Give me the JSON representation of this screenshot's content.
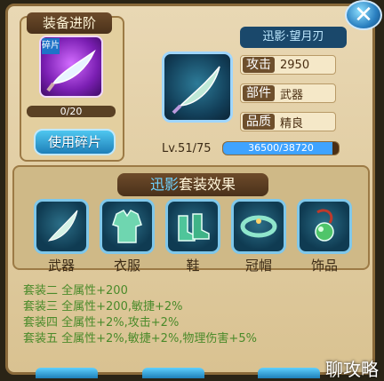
{
  "window": {
    "close_icon": "close-icon"
  },
  "upgrade_panel": {
    "title": "装备进阶",
    "item_icon": "curved-blade-icon",
    "fragment_tag": "碎片",
    "progress": {
      "text": "0/20",
      "current": 0,
      "max": 20
    },
    "use_button_label": "使用碎片"
  },
  "weapon": {
    "icon": "curved-blade-icon",
    "name": "迅影·望月刃",
    "stats": [
      {
        "label": "攻击",
        "value": "2950"
      },
      {
        "label": "部件",
        "value": "武器"
      },
      {
        "label": "品质",
        "value": "精良"
      }
    ],
    "level_text": "Lv.51/75",
    "exp": {
      "text": "36500/38720",
      "current": 36500,
      "max": 38720
    }
  },
  "set": {
    "title_highlight": "迅影",
    "title_rest": "套装效果",
    "slots": [
      {
        "label": "武器",
        "icon": "curved-blade-icon"
      },
      {
        "label": "衣服",
        "icon": "armor-icon"
      },
      {
        "label": "鞋",
        "icon": "boots-icon"
      },
      {
        "label": "冠帽",
        "icon": "helmet-icon"
      },
      {
        "label": "饰品",
        "icon": "amulet-icon"
      }
    ],
    "bonuses": [
      "套装二 全属性+200",
      "套装三 全属性+200,敏捷+2%",
      "套装四 全属性+2%,攻击+2%",
      "套装五 全属性+2%,敏捷+2%,物理伤害+5%"
    ]
  },
  "watermark": "聊攻略",
  "colors": {
    "accent_blue": "#3fa3ff",
    "bonus_green": "#4a8a2a",
    "frame_brown": "#8a6a3a"
  }
}
